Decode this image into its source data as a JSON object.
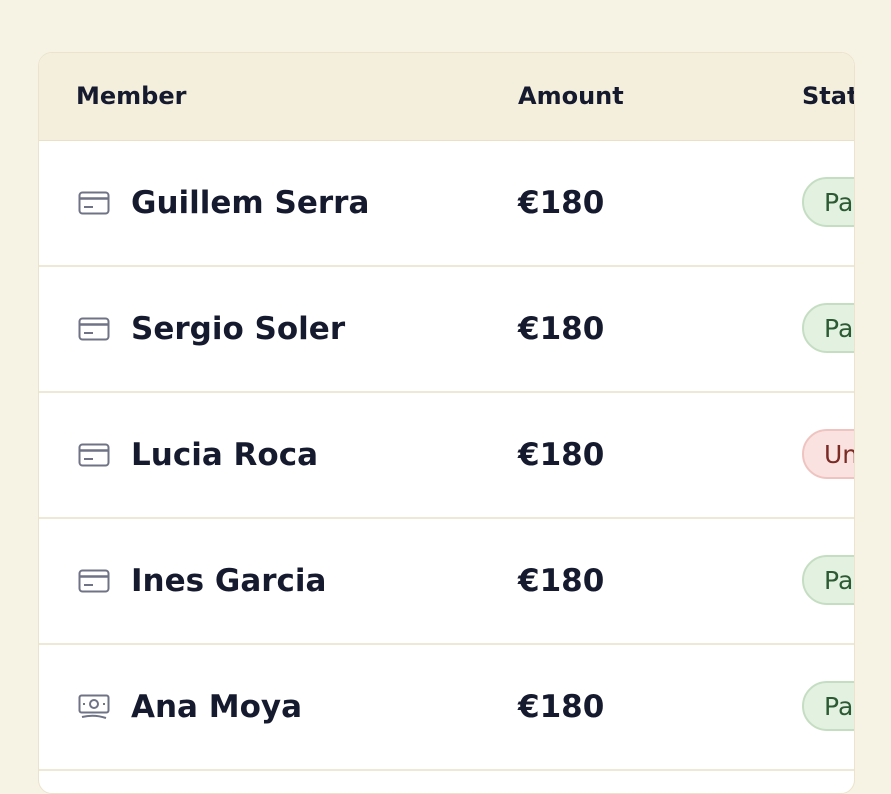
{
  "table": {
    "columns": {
      "member": "Member",
      "amount": "Amount",
      "status": "Status"
    },
    "rows": [
      {
        "icon": "card-icon",
        "member": "Guillem Serra",
        "amount": "€180",
        "status": "Paid",
        "status_kind": "paid"
      },
      {
        "icon": "card-icon",
        "member": "Sergio Soler",
        "amount": "€180",
        "status": "Paid",
        "status_kind": "paid"
      },
      {
        "icon": "card-icon",
        "member": "Lucia Roca",
        "amount": "€180",
        "status": "Unpaid",
        "status_kind": "unpaid"
      },
      {
        "icon": "card-icon",
        "member": "Ines Garcia",
        "amount": "€180",
        "status": "Paid",
        "status_kind": "paid"
      },
      {
        "icon": "cash-icon",
        "member": "Ana Moya",
        "amount": "€180",
        "status": "Paid",
        "status_kind": "paid"
      }
    ]
  },
  "colors": {
    "background": "#f6f2e4",
    "header_background": "#f4eedc",
    "text": "#161a2e",
    "paid_badge": "#e3f1e1",
    "unpaid_badge": "#fae2e0"
  }
}
